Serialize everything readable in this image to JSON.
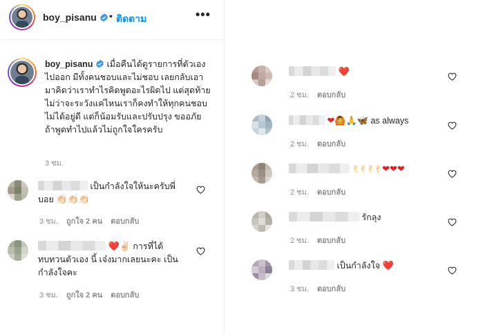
{
  "header": {
    "username": "boy_pisanu",
    "dot": "•",
    "follow_label": "ติดตาม",
    "more_label": "•••"
  },
  "caption": {
    "username": "boy_pisanu",
    "text": "เมื่อคืนได้ดูรายการที่ตัวเองไปออก มีทั้งคนชอบและไม่ชอบ เลยกลับเอามาคิดว่าเราทำไรคิดพูดอะไรผิดไป แต่สุดท้ายไม่ว่าจะระวังแค่ไหนเราก็คงทำให้ทุกคนชอบไม่ได้อยู่ดี แต่ก็น้อมรับและปรับปรุง ขออภัยถ้าพูดทำไปแล้วไม่ถูกใจใครครับ",
    "time": "3 ชม."
  },
  "reply_label": "ตอบกลับ",
  "comments_left": [
    {
      "text": "เป็นกำลังใจให้นะครับพี่บอย",
      "emoji": "👏🏻👏🏻👏🏻",
      "time": "3 ชม.",
      "likes": "ถูกใจ 2 คน"
    },
    {
      "emoji": "❤️✌🏻",
      "text": "การที่ได้ทบทวนตัวเอง นี้ เจ๋งมากเลยนะคะ เป็นกำลังใจคะ",
      "time": "3 ชม.",
      "likes": "ถูกใจ 2 คน"
    }
  ],
  "comments_right": [
    {
      "text": "",
      "emoji": "❤️",
      "time": "2 ชม."
    },
    {
      "text": "as always",
      "emoji": "❤️🙆‍♀️🙏🏻🦋",
      "time": "2 ชม."
    },
    {
      "text": "",
      "emoji": "✌🏻✌🏻✌🏻✌🏻❤️❤️❤️",
      "time": "2 ชม."
    },
    {
      "text": "รักลุง",
      "emoji": "",
      "time": "2 ชม."
    },
    {
      "text": "เป็นกำลังใจ",
      "emoji": "❤️",
      "time": "3 ชม."
    }
  ],
  "colors": {
    "link_blue": "#0095f6",
    "meta_gray": "#8e8e8e",
    "text": "#262626",
    "heart_red": "#ed1c24"
  }
}
